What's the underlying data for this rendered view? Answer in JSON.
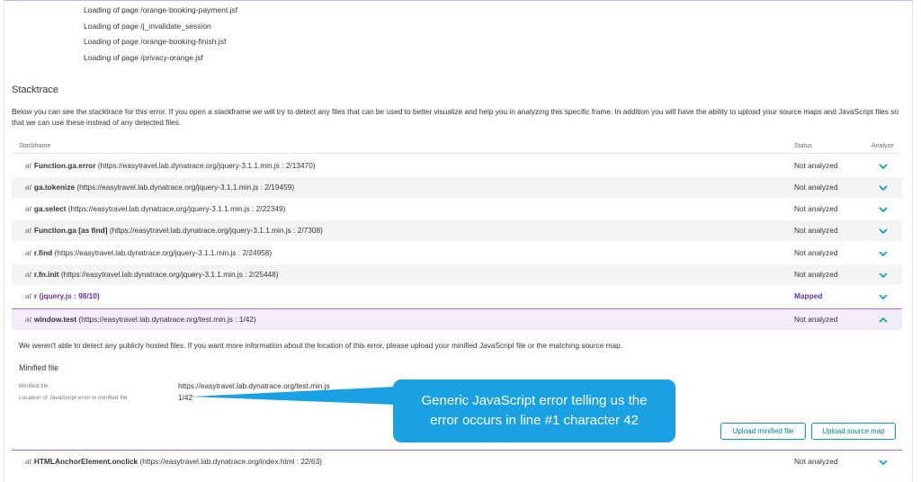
{
  "pages": [
    "Loading of page /orange-booking-payment.jsf",
    "Loading of page /j_invalidate_session",
    "Loading of page /orange-booking-finish.jsf",
    "Loading of page /privacy-orange.jsf"
  ],
  "stacktrace": {
    "title": "Stacktrace",
    "description": "Below you can see the stacktrace for this error. If you open a stackframe we will try to detect any files that can be used to better visualize and help you in analyzing this specific frame. In addition you will have the ability to upload your source maps and JavaScript files so that we can use these instead of any detected files.",
    "columns": {
      "frame": "Stackframe",
      "status": "Status",
      "analyze": "Analyze"
    },
    "at_label": "at",
    "rows": [
      {
        "fn": "Function.ga.error",
        "loc": "(https://easytravel.lab.dynatrace.org/jquery-3.1.1.min.js : 2/13470)",
        "status": "Not analyzed"
      },
      {
        "fn": "ga.tokenize",
        "loc": "(https://easytravel.lab.dynatrace.org/jquery-3.1.1.min.js : 2/19459)",
        "status": "Not analyzed"
      },
      {
        "fn": "ga.select",
        "loc": "(https://easytravel.lab.dynatrace.org/jquery-3.1.1.min.js : 2/22349)",
        "status": "Not analyzed"
      },
      {
        "fn": "Function.ga [as find]",
        "loc": "(https://easytravel.lab.dynatrace.org/jquery-3.1.1.min.js : 2/7308)",
        "status": "Not analyzed"
      },
      {
        "fn": "r.find",
        "loc": "(https://easytravel.lab.dynatrace.org/jquery-3.1.1.min.js : 2/24958)",
        "status": "Not analyzed"
      },
      {
        "fn": "r.fn.init",
        "loc": "(https://easytravel.lab.dynatrace.org/jquery-3.1.1.min.js : 2/25448)",
        "status": "Not analyzed"
      },
      {
        "fn": "r",
        "loc": "(jquery.js : 98/10)",
        "status": "Mapped"
      },
      {
        "fn": "window.test",
        "loc": "(https://easytravel.lab.dynatrace.org/test.min.js : 1/42)",
        "status": "Not analyzed"
      }
    ],
    "expanded": {
      "message": "We weren't able to detect any publicly hosted files. If you want more information about the location of this error, please upload your minified JavaScript file or the matching source map.",
      "minified_title": "Minified file",
      "minified_file_label": "Minified file",
      "minified_file_value": "https://easytravel.lab.dynatrace.org/test.min.js",
      "location_label": "Location of JavaScript error in minified file",
      "location_value": "1/42",
      "upload_minified": "Upload minified file",
      "upload_sourcemap": "Upload source map"
    },
    "last_row": {
      "fn": "HTMLAnchorElement.onclick",
      "loc": "(https://easytravel.lab.dynatrace.org/index.html : 22/63)",
      "status": "Not analyzed"
    }
  },
  "callout": {
    "line1": "Generic JavaScript error telling us the",
    "line2": "error occurs in line #1 character 42"
  },
  "icons": {
    "expand": "chevron-down-icon",
    "collapse": "chevron-up-icon"
  },
  "colors": {
    "accent": "#00a1b2",
    "mapped": "#6d2fa0",
    "callout": "#1aa1e3",
    "selected_row": "#f2ebf8"
  }
}
